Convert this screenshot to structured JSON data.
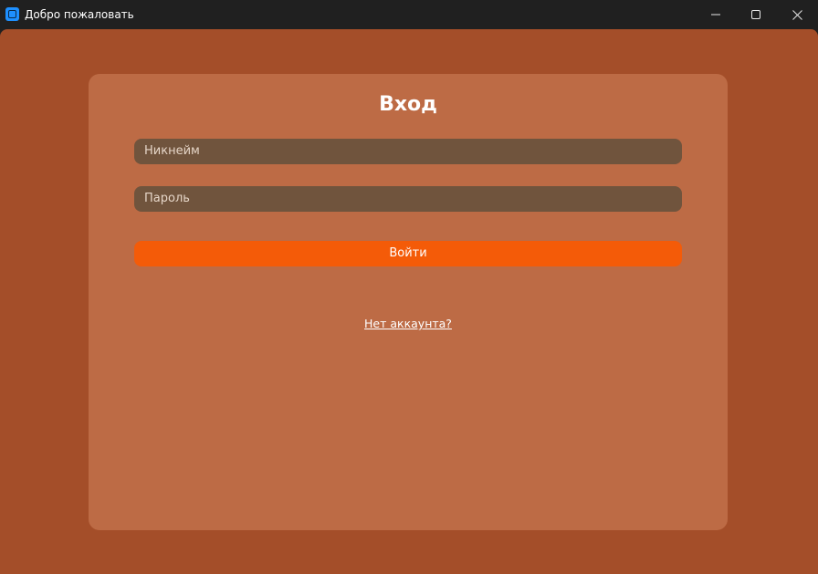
{
  "window": {
    "title": "Добро пожаловать",
    "icon": "app-icon",
    "controls": {
      "minimize": "minimize-icon",
      "maximize": "maximize-icon",
      "close": "close-icon"
    }
  },
  "login": {
    "heading": "Вход",
    "nickname_placeholder": "Никнейм",
    "password_placeholder": "Пароль",
    "submit_label": "Войти",
    "register_link": "Нет аккаунта?"
  },
  "colors": {
    "titlebar": "#202020",
    "background": "#a44e29",
    "card": "#bd6b45",
    "field": "#70543d",
    "accent": "#f45b08"
  }
}
